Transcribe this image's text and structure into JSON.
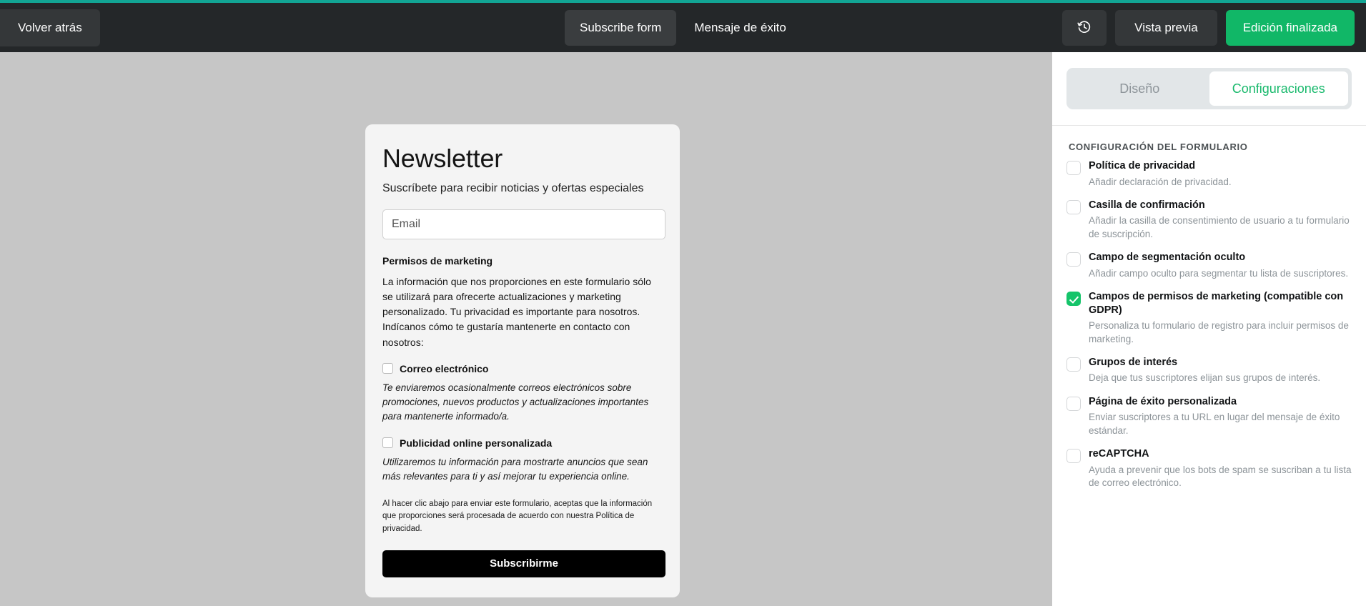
{
  "toolbar": {
    "back_label": "Volver atrás",
    "pages": [
      {
        "label": "Subscribe form",
        "active": true
      },
      {
        "label": "Mensaje de éxito",
        "active": false
      }
    ],
    "history_icon": "history-clock-icon",
    "preview_label": "Vista previa",
    "done_label": "Edición finalizada",
    "accent_color": "#11b767",
    "top_accent_color": "#12a594",
    "bar_color": "#242729"
  },
  "canvas": {
    "background_color": "#c6c6c6",
    "form": {
      "title": "Newsletter",
      "subtitle": "Suscríbete para recibir noticias y ofertas especiales",
      "email_placeholder": "Email",
      "email_value": "",
      "permissions_heading": "Permisos de marketing",
      "permissions_intro": "La información que nos proporciones en este formulario sólo se utilizará para ofrecerte actualizaciones y marketing personalizado. Tu privacidad es importante para nosotros. Indícanos cómo te gustaría mantenerte en contacto con nosotros:",
      "permissions": [
        {
          "label": "Correo electrónico",
          "checked": false,
          "description": "Te enviaremos ocasionalmente correos electrónicos sobre promociones, nuevos productos y actualizaciones importantes para mantenerte informado/a."
        },
        {
          "label": "Publicidad online personalizada",
          "checked": false,
          "description": "Utilizaremos tu información para mostrarte anuncios que sean más relevantes para ti y así mejorar tu experiencia online."
        }
      ],
      "fineprint": "Al hacer clic abajo para enviar este formulario, aceptas que la información que proporciones será procesada de acuerdo con nuestra Política de privacidad.",
      "submit_label": "Subscribirme"
    }
  },
  "panel": {
    "tabs": [
      {
        "label": "Diseño",
        "active": false
      },
      {
        "label": "Configuraciones",
        "active": true
      }
    ],
    "section_title": "CONFIGURACIÓN DEL FORMULARIO",
    "options": [
      {
        "title": "Política de privacidad",
        "description": "Añadir declaración de privacidad.",
        "checked": false
      },
      {
        "title": "Casilla de confirmación",
        "description": "Añadir la casilla de consentimiento de usuario a tu formulario de suscripción.",
        "checked": false
      },
      {
        "title": "Campo de segmentación oculto",
        "description": "Añadir campo oculto para segmentar tu lista de suscriptores.",
        "checked": false
      },
      {
        "title": "Campos de permisos de marketing (compatible con GDPR)",
        "description": "Personaliza tu formulario de registro para incluir permisos de marketing.",
        "checked": true
      },
      {
        "title": "Grupos de interés",
        "description": "Deja que tus suscriptores elijan sus grupos de interés.",
        "checked": false
      },
      {
        "title": "Página de éxito personalizada",
        "description": "Enviar suscriptores a tu URL en lugar del mensaje de éxito estándar.",
        "checked": false
      },
      {
        "title": "reCAPTCHA",
        "description": "Ayuda a prevenir que los bots de spam se suscriban a tu lista de correo electrónico.",
        "checked": false
      }
    ],
    "checked_color": "#15c46a",
    "active_tab_color": "#18b96c"
  }
}
